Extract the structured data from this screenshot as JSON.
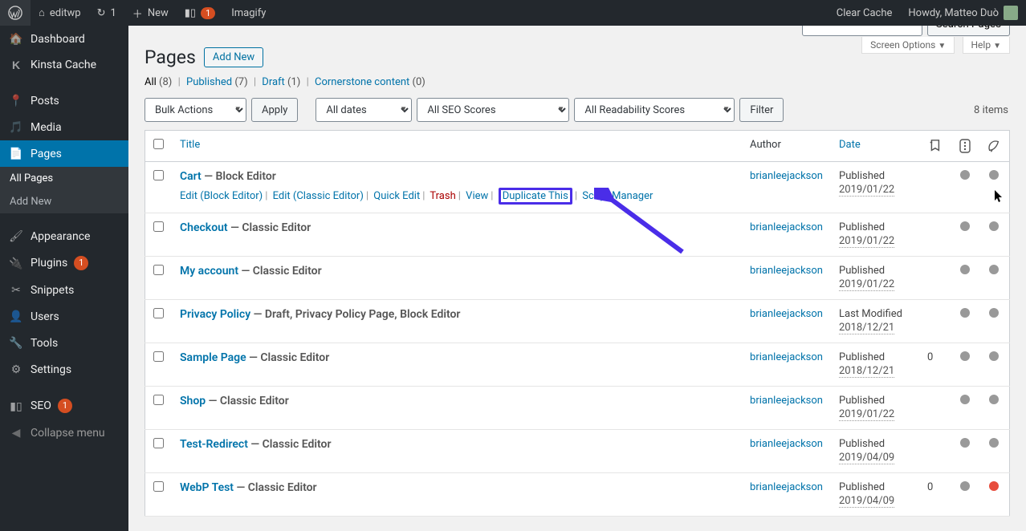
{
  "adminbar": {
    "site": "editwp",
    "updates": "1",
    "new": "New",
    "imagify": "Imagify",
    "clear": "Clear Cache",
    "howdy": "Howdy, Matteo Duò"
  },
  "sidebar": {
    "items": [
      {
        "label": "Dashboard",
        "icon": "⌂"
      },
      {
        "label": "Kinsta Cache",
        "icon": "K"
      },
      {
        "label": "Posts",
        "icon": "📌"
      },
      {
        "label": "Media",
        "icon": "🖼"
      },
      {
        "label": "Pages",
        "icon": "📄",
        "active": true
      },
      {
        "label": "Appearance",
        "icon": "🖌"
      },
      {
        "label": "Plugins",
        "icon": "🔌",
        "count": "1"
      },
      {
        "label": "Snippets",
        "icon": "✂"
      },
      {
        "label": "Users",
        "icon": "👤"
      },
      {
        "label": "Tools",
        "icon": "🔧"
      },
      {
        "label": "Settings",
        "icon": "⚙"
      },
      {
        "label": "SEO",
        "icon": "◐",
        "count": "1"
      },
      {
        "label": "Collapse menu",
        "icon": "◀"
      }
    ],
    "sub": {
      "all": "All Pages",
      "add": "Add New"
    }
  },
  "top": {
    "screen": "Screen Options",
    "help": "Help"
  },
  "heading": {
    "title": "Pages",
    "addnew": "Add New"
  },
  "subsub": {
    "all": "All",
    "all_n": "(8)",
    "pub": "Published",
    "pub_n": "(7)",
    "draft": "Draft",
    "draft_n": "(1)",
    "corner": "Cornerstone content",
    "corner_n": "(0)"
  },
  "filters": {
    "bulk": "Bulk Actions",
    "apply": "Apply",
    "dates": "All dates",
    "seo": "All SEO Scores",
    "read": "All Readability Scores",
    "filter": "Filter"
  },
  "search": {
    "btn": "Search Pages"
  },
  "count": "8 items",
  "th": {
    "title": "Title",
    "author": "Author",
    "date": "Date"
  },
  "row_actions": {
    "edit_block": "Edit (Block Editor)",
    "edit_classic": "Edit (Classic Editor)",
    "quick": "Quick Edit",
    "trash": "Trash",
    "view": "View",
    "dup": "Duplicate This",
    "sm": "Script Manager"
  },
  "rows": [
    {
      "title": "Cart",
      "state": " — Block Editor",
      "author": "brianleejackson",
      "dlab": "Published",
      "date": "2019/01/22",
      "show_actions": true
    },
    {
      "title": "Checkout",
      "state": " — Classic Editor",
      "author": "brianleejackson",
      "dlab": "Published",
      "date": "2019/01/22"
    },
    {
      "title": "My account",
      "state": " — Classic Editor",
      "author": "brianleejackson",
      "dlab": "Published",
      "date": "2019/01/22"
    },
    {
      "title": "Privacy Policy",
      "state": " — Draft, Privacy Policy Page, Block Editor",
      "author": "brianleejackson",
      "dlab": "Last Modified",
      "date": "2018/12/21"
    },
    {
      "title": "Sample Page",
      "state": " — Classic Editor",
      "author": "brianleejackson",
      "dlab": "Published",
      "date": "2018/12/21",
      "comments": "0"
    },
    {
      "title": "Shop",
      "state": " — Classic Editor",
      "author": "brianleejackson",
      "dlab": "Published",
      "date": "2019/01/22"
    },
    {
      "title": "Test-Redirect",
      "state": " — Classic Editor",
      "author": "brianleejackson",
      "dlab": "Published",
      "date": "2019/04/09"
    },
    {
      "title": "WebP Test",
      "state": " — Classic Editor",
      "author": "brianleejackson",
      "dlab": "Published",
      "date": "2019/04/09",
      "comments": "0",
      "red": true
    }
  ]
}
